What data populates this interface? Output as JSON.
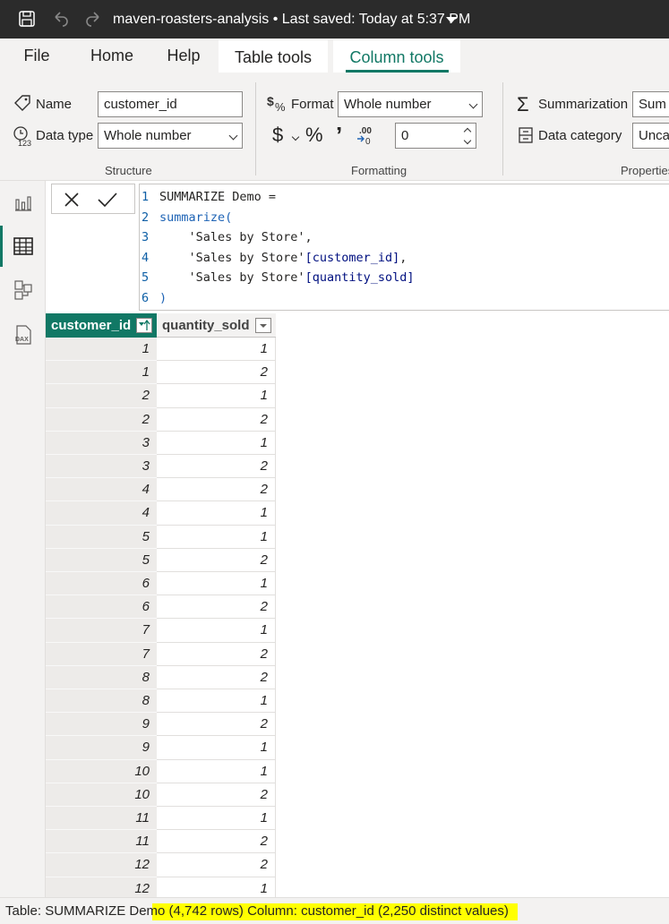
{
  "titlebar": {
    "title": "maven-roasters-analysis • Last saved: Today at 5:37 PM"
  },
  "tabs": [
    {
      "label": "File"
    },
    {
      "label": "Home"
    },
    {
      "label": "Help"
    },
    {
      "label": "Table tools"
    },
    {
      "label": "Column tools"
    }
  ],
  "ribbon": {
    "structure": {
      "name_label": "Name",
      "name_value": "customer_id",
      "datatype_label": "Data type",
      "datatype_value": "Whole number",
      "group_label": "Structure"
    },
    "formatting": {
      "format_label": "Format",
      "format_value": "Whole number",
      "currency_symbol": "$",
      "percent_symbol": "%",
      "comma_symbol": "’",
      "decimal_symbol": ".00",
      "decimals_value": "0",
      "group_label": "Formatting"
    },
    "properties": {
      "summarization_label": "Summarization",
      "summarization_value": "Sum",
      "category_label": "Data category",
      "category_value": "Uncat",
      "group_label": "Properties"
    }
  },
  "formula": {
    "lines": [
      {
        "num": "1",
        "segments": [
          {
            "t": "SUMMARIZE Demo =",
            "c": ""
          }
        ]
      },
      {
        "num": "2",
        "segments": [
          {
            "t": "summarize(",
            "c": "k-fn"
          }
        ]
      },
      {
        "num": "3",
        "segments": [
          {
            "t": "    'Sales by Store',",
            "c": ""
          }
        ]
      },
      {
        "num": "4",
        "segments": [
          {
            "t": "    'Sales by Store'",
            "c": ""
          },
          {
            "t": "[customer_id]",
            "c": "k-col"
          },
          {
            "t": ",",
            "c": ""
          }
        ]
      },
      {
        "num": "5",
        "segments": [
          {
            "t": "    'Sales by Store'",
            "c": ""
          },
          {
            "t": "[quantity_sold]",
            "c": "k-col"
          }
        ]
      },
      {
        "num": "6",
        "segments": [
          {
            "t": ")",
            "c": "k-fn"
          }
        ]
      }
    ]
  },
  "table": {
    "columns": [
      "customer_id",
      "quantity_sold"
    ],
    "rows": [
      [
        "1",
        "1"
      ],
      [
        "1",
        "2"
      ],
      [
        "2",
        "1"
      ],
      [
        "2",
        "2"
      ],
      [
        "3",
        "1"
      ],
      [
        "3",
        "2"
      ],
      [
        "4",
        "2"
      ],
      [
        "4",
        "1"
      ],
      [
        "5",
        "1"
      ],
      [
        "5",
        "2"
      ],
      [
        "6",
        "1"
      ],
      [
        "6",
        "2"
      ],
      [
        "7",
        "1"
      ],
      [
        "7",
        "2"
      ],
      [
        "8",
        "2"
      ],
      [
        "8",
        "1"
      ],
      [
        "9",
        "2"
      ],
      [
        "9",
        "1"
      ],
      [
        "10",
        "1"
      ],
      [
        "10",
        "2"
      ],
      [
        "11",
        "1"
      ],
      [
        "11",
        "2"
      ],
      [
        "12",
        "2"
      ],
      [
        "12",
        "1"
      ]
    ]
  },
  "status": {
    "text": "Table: SUMMARIZE Demo (4,742 rows) Column: customer_id (2,250 distinct values)"
  },
  "colors": {
    "accent": "#117865",
    "highlight": "#ffff00"
  }
}
